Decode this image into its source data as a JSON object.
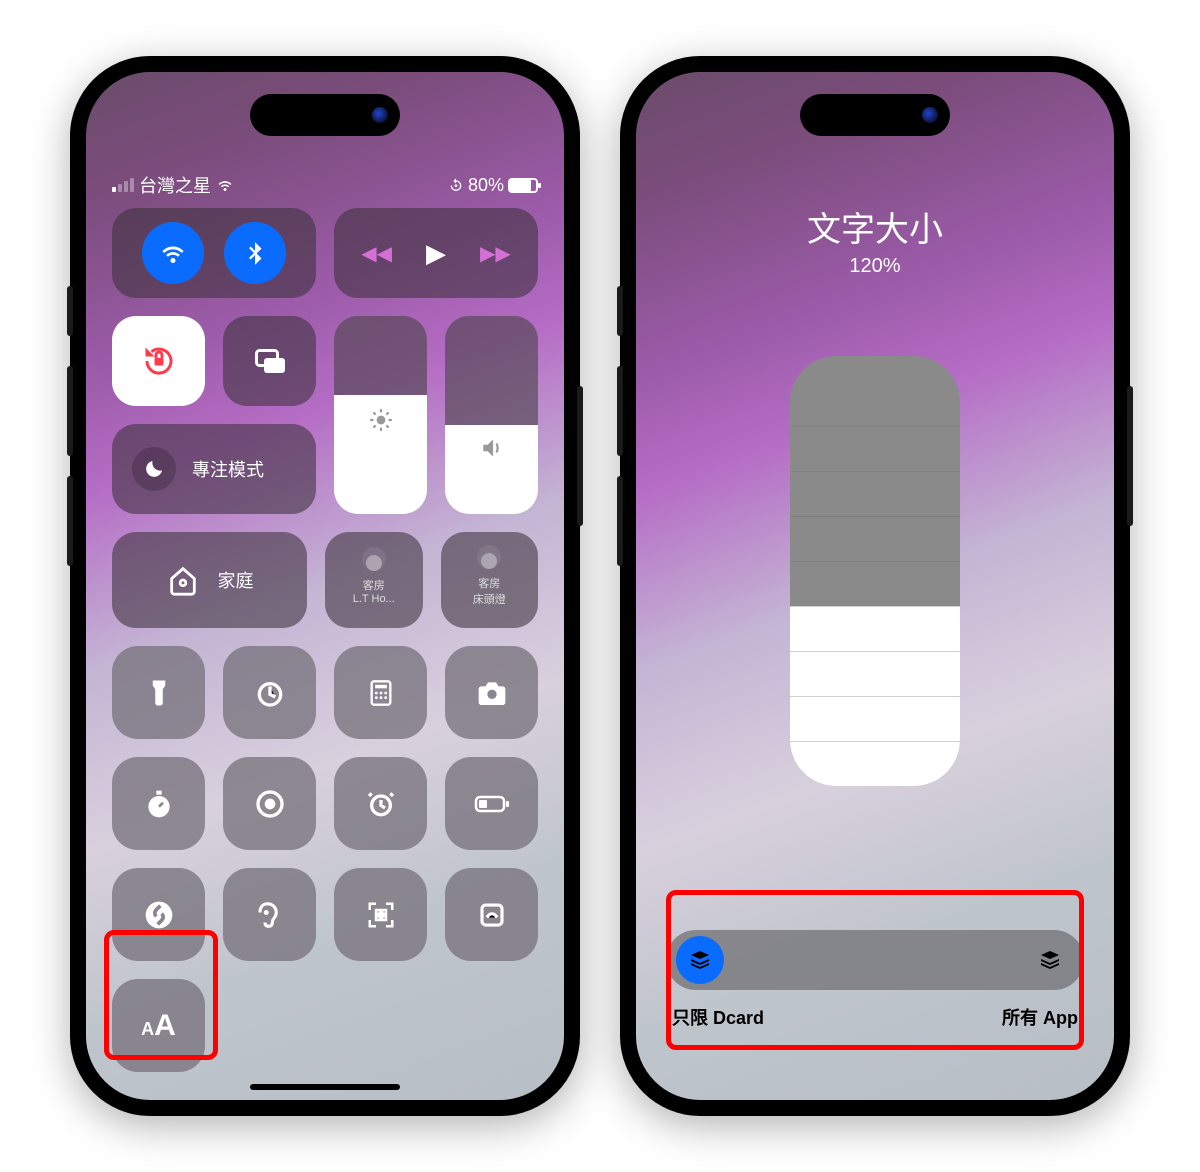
{
  "status": {
    "carrier": "台灣之星",
    "battery_pct": "80%"
  },
  "control_center": {
    "focus_label": "專注模式",
    "home_label": "家庭",
    "accessory1": "客房\nL.T Ho...",
    "accessory2": "客房\n床頭燈"
  },
  "text_size_panel": {
    "title": "文字大小",
    "percentage": "120%",
    "scope_left": "只限 Dcard",
    "scope_right": "所有 App",
    "total_steps": 10,
    "filled_steps": 4
  },
  "colors": {
    "accent_blue": "#0a6cff",
    "highlight_red": "#ff0000"
  }
}
